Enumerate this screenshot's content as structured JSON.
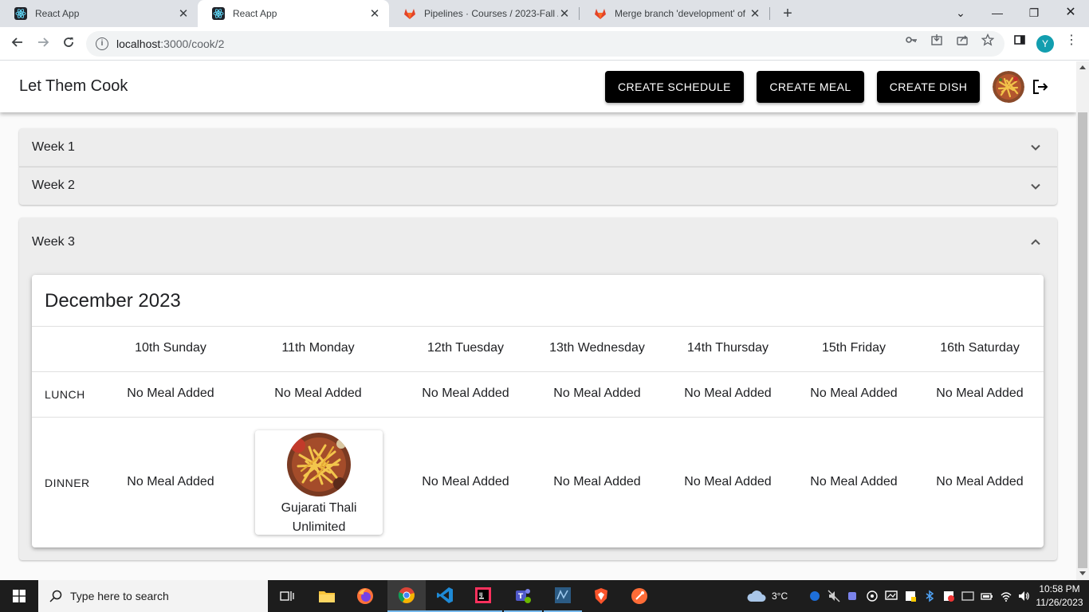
{
  "browser": {
    "tabs": [
      {
        "title": "React App",
        "active": false,
        "favicon": "react-icon"
      },
      {
        "title": "React App",
        "active": true,
        "favicon": "react-icon"
      },
      {
        "title": "Pipelines · Courses / 2023-Fall / C",
        "active": false,
        "favicon": "gitlab-icon"
      },
      {
        "title": "Merge branch 'development' of",
        "active": false,
        "favicon": "gitlab-icon"
      }
    ],
    "url_host": "localhost",
    "url_path": ":3000/cook/2",
    "profile_initial": "Y"
  },
  "app": {
    "brand": "Let Them Cook",
    "buttons": {
      "create_schedule": "CREATE SCHEDULE",
      "create_meal": "CREATE MEAL",
      "create_dish": "CREATE DISH"
    }
  },
  "weeks": [
    {
      "label": "Week 1",
      "expanded": false
    },
    {
      "label": "Week 2",
      "expanded": false
    },
    {
      "label": "Week 3",
      "expanded": true
    }
  ],
  "calendar": {
    "month": "December 2023",
    "days": [
      "10th Sunday",
      "11th Monday",
      "12th Tuesday",
      "13th Wednesday",
      "14th Thursday",
      "15th Friday",
      "16th Saturday"
    ],
    "slots": {
      "lunch": {
        "label": "LUNCH",
        "cells": [
          "No Meal Added",
          "No Meal Added",
          "No Meal Added",
          "No Meal Added",
          "No Meal Added",
          "No Meal Added",
          "No Meal Added"
        ]
      },
      "dinner": {
        "label": "DINNER",
        "cells": [
          "No Meal Added",
          "",
          "No Meal Added",
          "No Meal Added",
          "No Meal Added",
          "No Meal Added",
          "No Meal Added"
        ],
        "meal": {
          "name_line1": "Gujarati Thali",
          "name_line2": "Unlimited"
        }
      }
    }
  },
  "taskbar": {
    "search_placeholder": "Type here to search",
    "weather": "3°C",
    "time": "10:58 PM",
    "date": "11/26/2023"
  }
}
